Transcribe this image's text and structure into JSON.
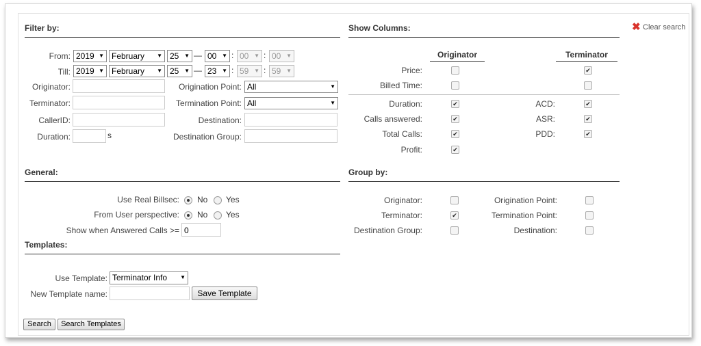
{
  "filter": {
    "title": "Filter by:",
    "from_label": "From:",
    "till_label": "Till:",
    "from": {
      "year": "2019",
      "month": "February",
      "day": "25",
      "hour": "00",
      "minute": "00",
      "second": "00"
    },
    "till": {
      "year": "2019",
      "month": "February",
      "day": "25",
      "hour": "23",
      "minute": "59",
      "second": "59"
    },
    "dash": "—",
    "colon": ":",
    "originator_label": "Originator:",
    "terminator_label": "Terminator:",
    "callerid_label": "CallerID:",
    "duration_label": "Duration:",
    "duration_unit": "s",
    "origination_point_label": "Origination Point:",
    "origination_point_value": "All",
    "termination_point_label": "Termination Point:",
    "termination_point_value": "All",
    "destination_label": "Destination:",
    "destination_group_label": "Destination Group:"
  },
  "columns": {
    "title": "Show Columns:",
    "clear_search": "Clear search",
    "originator_head": "Originator",
    "terminator_head": "Terminator",
    "price": "Price:",
    "billed_time": "Billed Time:",
    "duration": "Duration:",
    "calls_answered": "Calls answered:",
    "total_calls": "Total Calls:",
    "profit": "Profit:",
    "acd": "ACD:",
    "asr": "ASR:",
    "pdd": "PDD:",
    "check": "✔"
  },
  "general": {
    "title": "General:",
    "real_billsec_label": "Use Real Billsec:",
    "user_perspective_label": "From User perspective:",
    "no": "No",
    "yes": "Yes",
    "answered_calls_label": "Show when Answered Calls >=",
    "answered_calls_value": "0"
  },
  "group": {
    "title": "Group by:",
    "originator": "Originator:",
    "terminator": "Terminator:",
    "destination_group": "Destination Group:",
    "origination_point": "Origination Point:",
    "termination_point": "Termination Point:",
    "destination": "Destination:"
  },
  "templates": {
    "title": "Templates:",
    "use_label": "Use Template:",
    "use_value": "Terminator Info",
    "new_name_label": "New Template name:",
    "save_button": "Save Template"
  },
  "actions": {
    "search": "Search",
    "search_templates": "Search Templates"
  },
  "colors": {
    "clear_icon": "#d9332b"
  }
}
